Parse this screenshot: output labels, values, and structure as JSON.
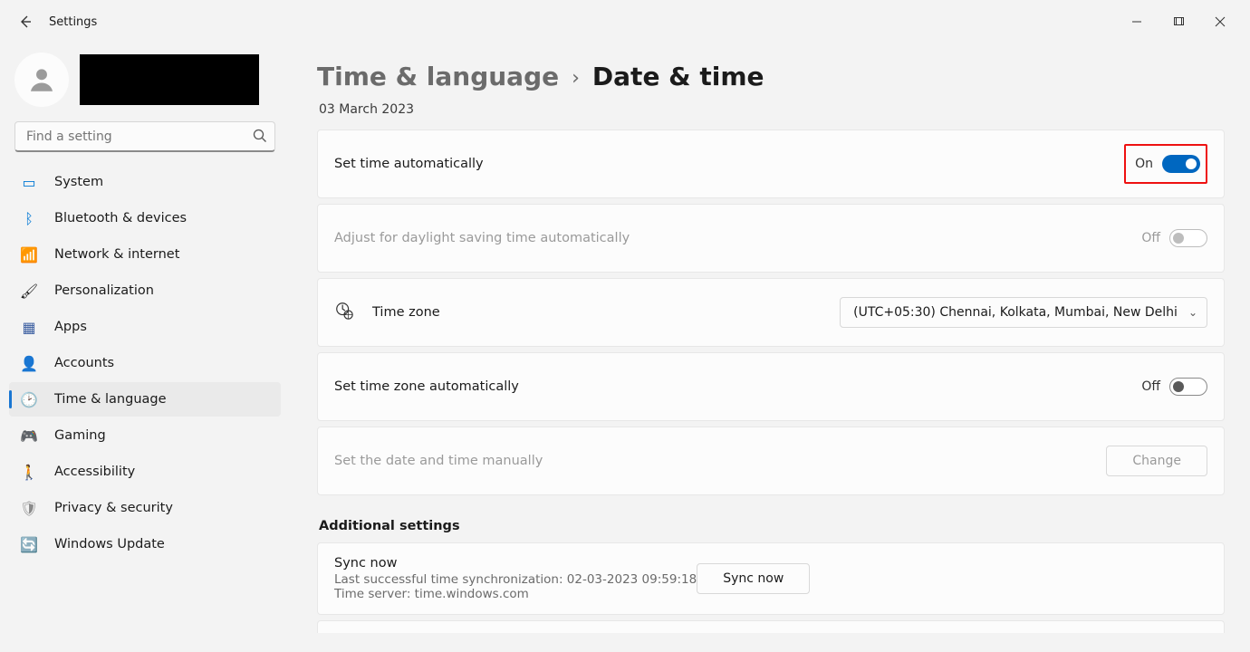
{
  "app_title": "Settings",
  "search_placeholder": "Find a setting",
  "sidebar": {
    "items": [
      {
        "label": "System",
        "icon": "💻"
      },
      {
        "label": "Bluetooth & devices",
        "icon": "ᛒ"
      },
      {
        "label": "Network & internet",
        "icon": "📶"
      },
      {
        "label": "Personalization",
        "icon": "🖌"
      },
      {
        "label": "Apps",
        "icon": "▦"
      },
      {
        "label": "Accounts",
        "icon": "👤"
      },
      {
        "label": "Time & language",
        "icon": "🕑"
      },
      {
        "label": "Gaming",
        "icon": "🎮"
      },
      {
        "label": "Accessibility",
        "icon": "🚶"
      },
      {
        "label": "Privacy & security",
        "icon": "🛡"
      },
      {
        "label": "Windows Update",
        "icon": "🔄"
      }
    ]
  },
  "breadcrumb": {
    "parent": "Time & language",
    "current": "Date & time"
  },
  "date_line": "03 March 2023",
  "rows": {
    "auto_time": {
      "label": "Set time automatically",
      "state": "On"
    },
    "dst": {
      "label": "Adjust for daylight saving time automatically",
      "state": "Off"
    },
    "tz": {
      "label": "Time zone",
      "value": "(UTC+05:30) Chennai, Kolkata, Mumbai, New Delhi"
    },
    "auto_tz": {
      "label": "Set time zone automatically",
      "state": "Off"
    },
    "manual": {
      "label": "Set the date and time manually",
      "button": "Change"
    }
  },
  "additional_title": "Additional settings",
  "sync": {
    "title": "Sync now",
    "last": "Last successful time synchronization: 02-03-2023 09:59:18",
    "server": "Time server: time.windows.com",
    "button": "Sync now"
  }
}
